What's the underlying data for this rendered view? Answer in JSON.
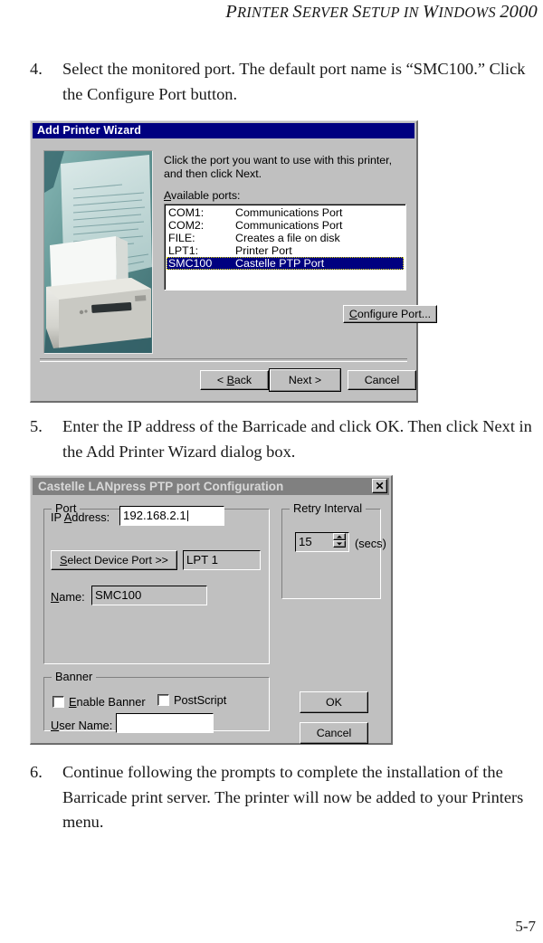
{
  "page": {
    "running_head_small_caps_1": "P",
    "running_head": "Printer Server Setup in Windows 2000",
    "running_head_parts": {
      "p1_cap": "P",
      "p1_rest": "RINTER ",
      "p2_cap": "S",
      "p2_rest": "ERVER ",
      "p3_cap": "S",
      "p3_rest": "ETUP ",
      "p4_rest": "IN ",
      "p5_cap": "W",
      "p5_rest": "INDOWS ",
      "p6": "2000"
    },
    "page_number": "5-7"
  },
  "steps": [
    {
      "number": "4.",
      "text": "Select the monitored port. The default port name is “SMC100.” Click the Configure Port button."
    },
    {
      "number": "5.",
      "text": "Enter the IP address of the Barricade and click OK. Then click Next in the Add Printer Wizard dialog box."
    },
    {
      "number": "6.",
      "text": "Continue following the prompts to complete the installation of the Barricade print server. The printer will now be added to your Printers menu."
    }
  ],
  "add_printer_wizard": {
    "title": "Add Printer Wizard",
    "prompt": "Click the port you want to use with this printer, and then click Next.",
    "available_ports_label_underlined": "A",
    "available_ports_label_rest": "vailable ports:",
    "ports": [
      {
        "name": "COM1:",
        "description": "Communications Port",
        "selected": false
      },
      {
        "name": "COM2:",
        "description": "Communications Port",
        "selected": false
      },
      {
        "name": "FILE:",
        "description": "Creates a file on disk",
        "selected": false
      },
      {
        "name": "LPT1:",
        "description": "Printer Port",
        "selected": false
      },
      {
        "name": "SMC100",
        "description": "Castelle  PTP  Port",
        "selected": true
      }
    ],
    "configure_port_accel": "C",
    "configure_port_rest": "onfigure Port...",
    "back_accel_prefix": "< ",
    "back_accel": "B",
    "back_rest": "ack",
    "next_label": "Next >",
    "cancel_label": "Cancel",
    "photo_alt": "printer-photo"
  },
  "castelle_dialog": {
    "title": "Castelle LANpress PTP port  Configuration",
    "close_label": "✕",
    "port_group_label": "Port",
    "ip_label_prefix": "IP ",
    "ip_label_accel": "A",
    "ip_label_rest": "ddress:",
    "ip_value": "192.168.2.1",
    "select_device_port_accel": "S",
    "select_device_port_rest": "elect Device Port >>",
    "device_port_value": "LPT 1",
    "name_label_accel": "N",
    "name_label_rest": "ame:",
    "name_value": "SMC100",
    "retry_group_label": "Retry Interval",
    "retry_value": "15",
    "retry_units": "(secs)",
    "banner_group_label": "Banner",
    "enable_banner_accel": "E",
    "enable_banner_rest": "nable Banner",
    "enable_banner_checked": false,
    "postscript_label": "PostScript",
    "postscript_checked": false,
    "user_name_accel": "U",
    "user_name_rest": "ser Name:",
    "user_name_value": "",
    "ok_label": "OK",
    "cancel_label": "Cancel"
  },
  "colors": {
    "titlebar_active": "#000080",
    "titlebar_inactive": "#808080",
    "dialog_face": "#c0c0c0",
    "selection": "#000080",
    "selection_text": "#ffffff"
  }
}
